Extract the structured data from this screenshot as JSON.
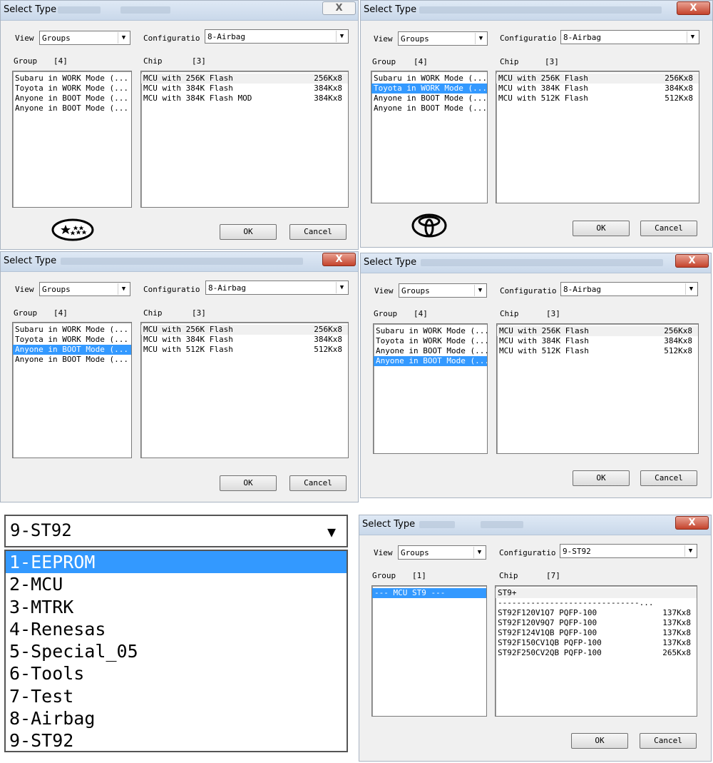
{
  "dialogs": [
    {
      "title": "Select Type",
      "view_label": "View",
      "view_value": "Groups",
      "config_label": "Configuratio",
      "config_value": "8-Airbag",
      "group_label": "Group",
      "group_count": "[4]",
      "chip_label": "Chip",
      "chip_count": "[3]",
      "groups": [
        "Subaru in WORK Mode (...",
        "Toyota in WORK Mode (...",
        "Anyone in BOOT Mode (...",
        "Anyone in BOOT Mode (..."
      ],
      "selected_group": -1,
      "chips": [
        {
          "name": "MCU with 256K Flash",
          "size": "256Kx8"
        },
        {
          "name": "MCU with 384K Flash",
          "size": "384Kx8"
        },
        {
          "name": "MCU with 384K Flash MOD",
          "size": "384Kx8"
        }
      ],
      "logo": "subaru-logo",
      "ok_label": "OK",
      "cancel_label": "Cancel",
      "close_label": "X"
    },
    {
      "title": "Select Type",
      "view_label": "View",
      "view_value": "Groups",
      "config_label": "Configuratio",
      "config_value": "8-Airbag",
      "group_label": "Group",
      "group_count": "[4]",
      "chip_label": "Chip",
      "chip_count": "[3]",
      "groups": [
        "Subaru in WORK Mode (...",
        "Toyota in WORK Mode (...",
        "Anyone in BOOT Mode (...",
        "Anyone in BOOT Mode (..."
      ],
      "selected_group": 1,
      "chips": [
        {
          "name": "MCU with 256K Flash",
          "size": "256Kx8"
        },
        {
          "name": "MCU with 384K Flash",
          "size": "384Kx8"
        },
        {
          "name": "MCU with 512K Flash",
          "size": "512Kx8"
        }
      ],
      "logo": "toyota-logo",
      "ok_label": "OK",
      "cancel_label": "Cancel",
      "close_label": "X"
    },
    {
      "title": "Select Type",
      "view_label": "View",
      "view_value": "Groups",
      "config_label": "Configuratio",
      "config_value": "8-Airbag",
      "group_label": "Group",
      "group_count": "[4]",
      "chip_label": "Chip",
      "chip_count": "[3]",
      "groups": [
        "Subaru in WORK Mode (...",
        "Toyota in WORK Mode (...",
        "Anyone in BOOT Mode (...",
        "Anyone in BOOT Mode (..."
      ],
      "selected_group": 2,
      "chips": [
        {
          "name": "MCU with 256K Flash",
          "size": "256Kx8"
        },
        {
          "name": "MCU with 384K Flash",
          "size": "384Kx8"
        },
        {
          "name": "MCU with 512K Flash",
          "size": "512Kx8"
        }
      ],
      "logo": "",
      "ok_label": "OK",
      "cancel_label": "Cancel",
      "close_label": "X"
    },
    {
      "title": "Select Type",
      "view_label": "View",
      "view_value": "Groups",
      "config_label": "Configuratio",
      "config_value": "8-Airbag",
      "group_label": "Group",
      "group_count": "[4]",
      "chip_label": "Chip",
      "chip_count": "[3]",
      "groups": [
        "Subaru in WORK Mode (...",
        "Toyota in WORK Mode (...",
        "Anyone in BOOT Mode (...",
        "Anyone in BOOT Mode (..."
      ],
      "selected_group": 3,
      "chips": [
        {
          "name": "MCU with 256K Flash",
          "size": "256Kx8"
        },
        {
          "name": "MCU with 384K Flash",
          "size": "384Kx8"
        },
        {
          "name": "MCU with 512K Flash",
          "size": "512Kx8"
        }
      ],
      "logo": "",
      "ok_label": "OK",
      "cancel_label": "Cancel",
      "close_label": "X"
    },
    {
      "title": "Select Type",
      "view_label": "View",
      "view_value": "Groups",
      "config_label": "Configuratio",
      "config_value": "9-ST92",
      "group_label": "Group",
      "group_count": "[1]",
      "chip_label": "Chip",
      "chip_count": "[7]",
      "groups": [
        "--- MCU ST9 ---"
      ],
      "selected_group": 0,
      "chips": [
        {
          "name": "ST9+",
          "size": ""
        },
        {
          "name": "------------------------------...",
          "size": ""
        },
        {
          "name": "ST92F120V1Q7 PQFP-100",
          "size": "137Kx8"
        },
        {
          "name": "ST92F120V9Q7 PQFP-100",
          "size": "137Kx8"
        },
        {
          "name": "ST92F124V1QB PQFP-100",
          "size": "137Kx8"
        },
        {
          "name": "ST92F150CV1QB PQFP-100",
          "size": "137Kx8"
        },
        {
          "name": "ST92F250CV2QB PQFP-100",
          "size": "265Kx8"
        }
      ],
      "logo": "",
      "ok_label": "OK",
      "cancel_label": "Cancel",
      "close_label": "X"
    }
  ],
  "config_dropdown": {
    "value": "9-ST92",
    "options": [
      "1-EEPROM",
      "2-MCU",
      "3-MTRK",
      "4-Renesas",
      "5-Special_05",
      "6-Tools",
      "7-Test",
      "8-Airbag",
      "9-ST92"
    ],
    "selected_index": 0,
    "highlight_color": "#3399ff"
  }
}
